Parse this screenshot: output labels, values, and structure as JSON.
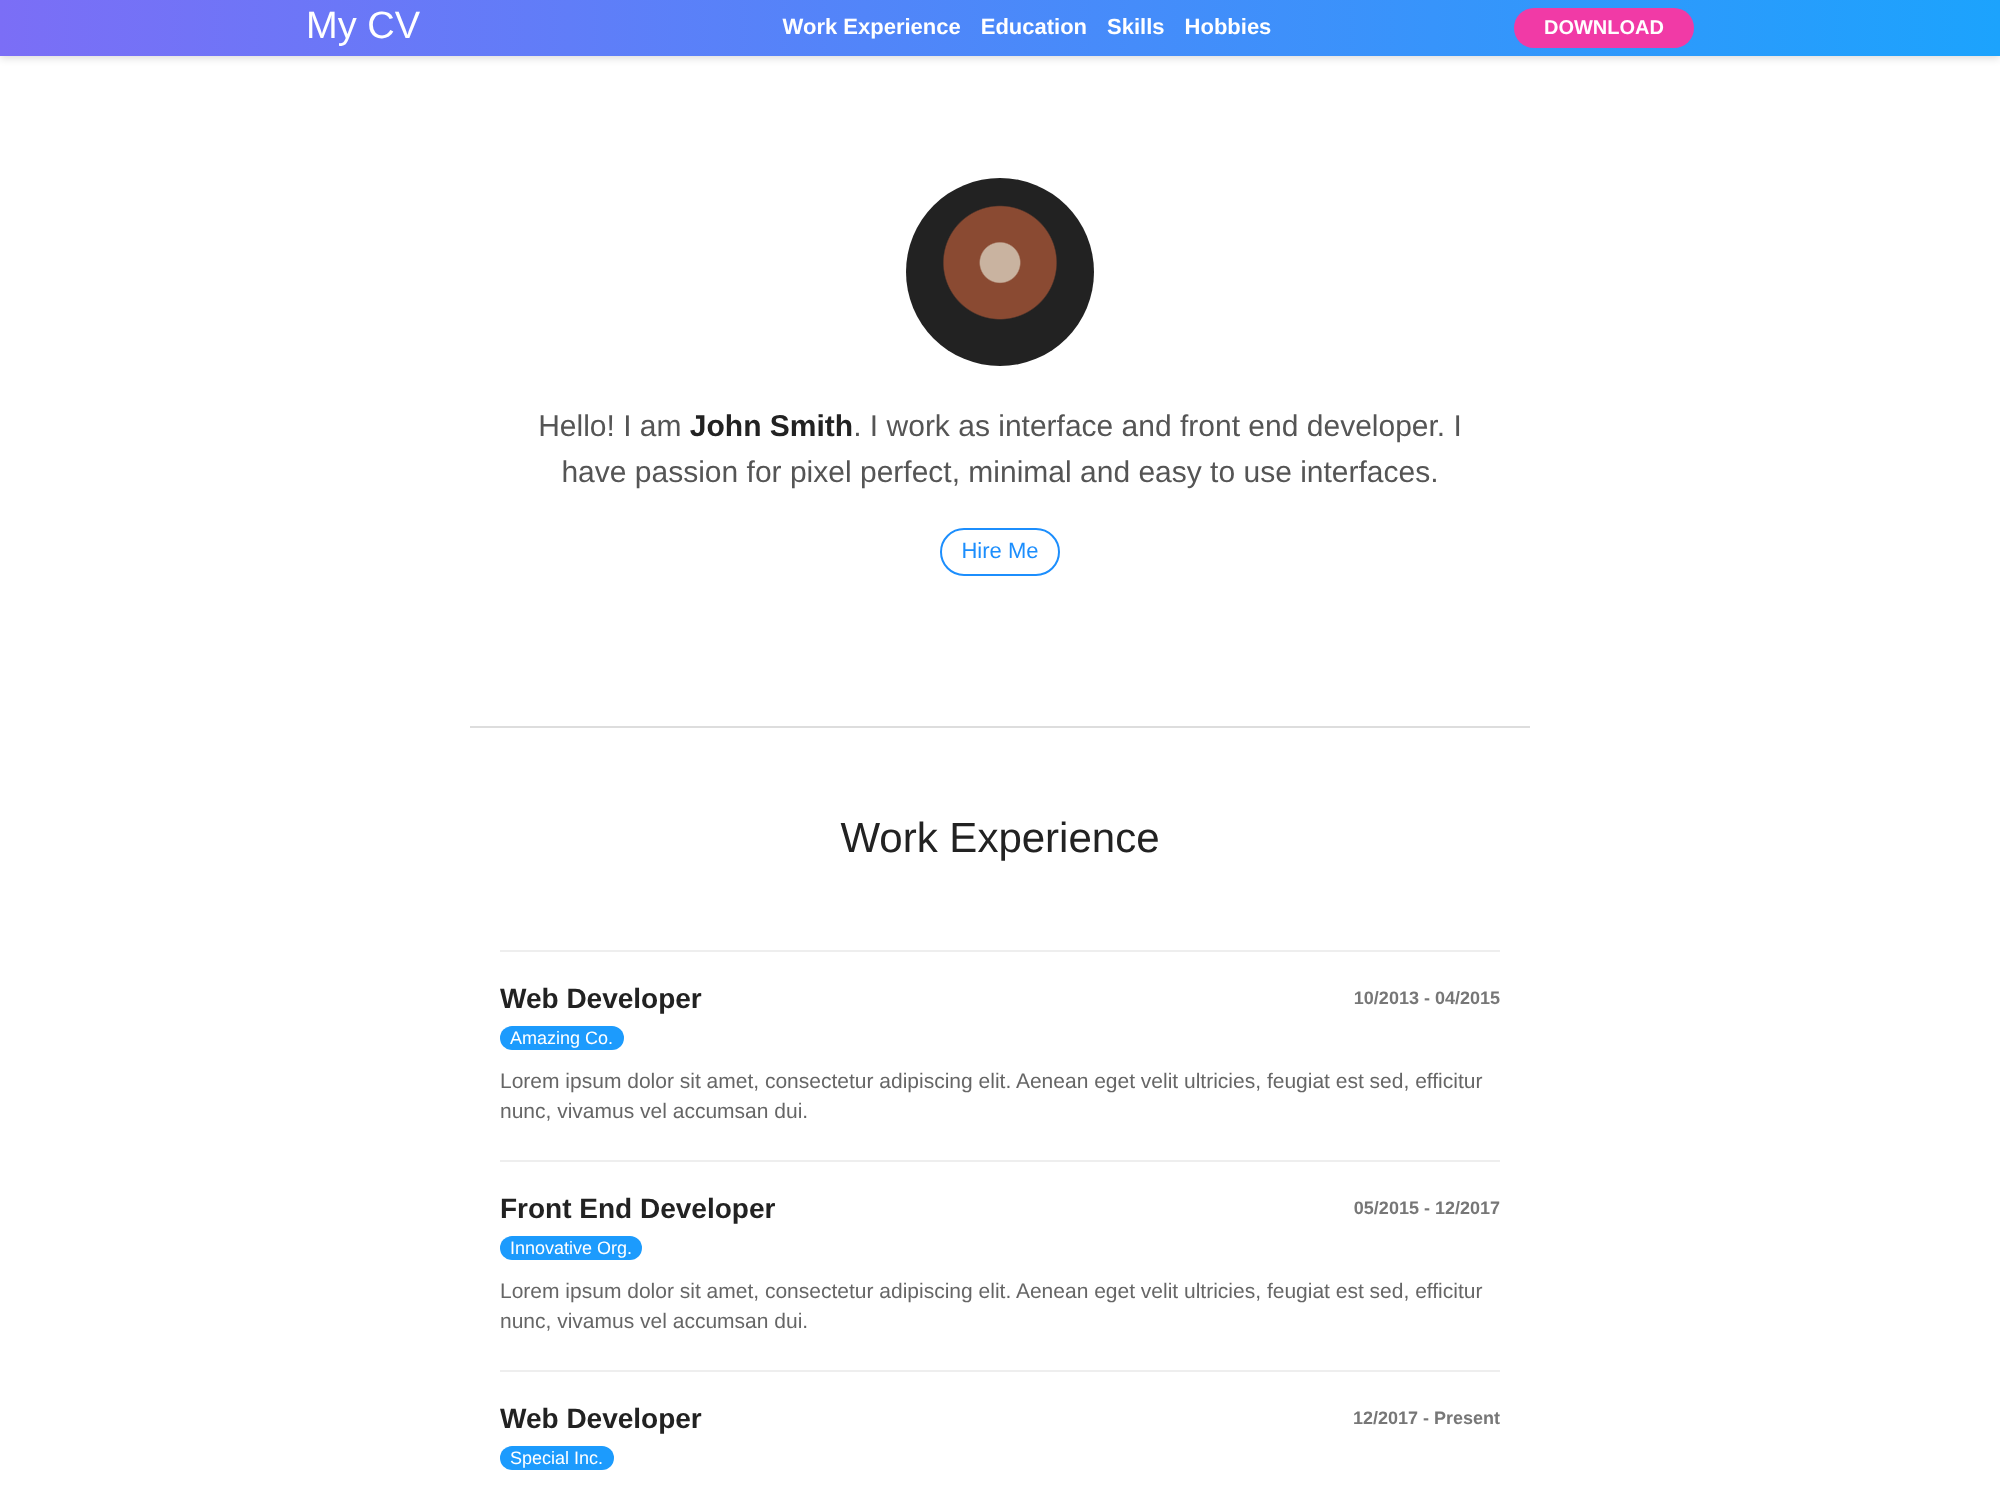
{
  "header": {
    "logo": "My CV",
    "nav": [
      "Work Experience",
      "Education",
      "Skills",
      "Hobbies"
    ],
    "download": "DOWNLOAD"
  },
  "intro": {
    "text": "Hello! I am **John Smith**. I work as interface and front end developer. I have passion for pixel perfect, minimal and easy to use interfaces.",
    "button": "Hire Me"
  },
  "work": {
    "title": "Work Experience",
    "jobs": [
      {
        "role": "Web Developer",
        "company": "Amazing Co.",
        "dates": "10/2013 - 04/2015",
        "description": "Lorem ipsum dolor sit amet, consectetur adipiscing elit. Aenean eget velit ultricies, feugiat est sed, efficitur nunc, vivamus vel accumsan dui."
      },
      {
        "role": "Front End Developer",
        "company": "Innovative Org.",
        "dates": "05/2015 - 12/2017",
        "description": "Lorem ipsum dolor sit amet, consectetur adipiscing elit. Aenean eget velit ultricies, feugiat est sed, efficitur nunc, vivamus vel accumsan dui."
      },
      {
        "role": "Web Developer",
        "company": "Special Inc.",
        "dates": "12/2017 - Present"
      }
    ]
  }
}
